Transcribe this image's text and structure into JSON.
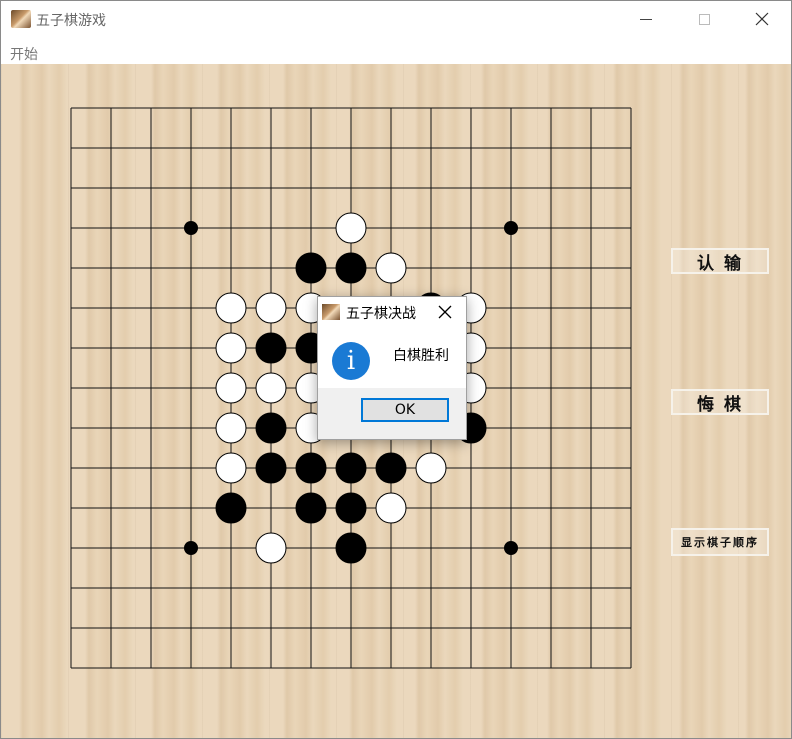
{
  "window": {
    "title": "五子棋游戏"
  },
  "menu": {
    "items": [
      "开始"
    ]
  },
  "buttons": {
    "resign": "认输",
    "undo": "悔棋",
    "show_order": "显示棋子顺序"
  },
  "board": {
    "size": 15,
    "star_points": [
      [
        3,
        3
      ],
      [
        11,
        3
      ],
      [
        3,
        11
      ],
      [
        11,
        11
      ]
    ],
    "stones": [
      {
        "col": 7,
        "row": 3,
        "color": "white"
      },
      {
        "col": 6,
        "row": 4,
        "color": "black"
      },
      {
        "col": 7,
        "row": 4,
        "color": "black"
      },
      {
        "col": 8,
        "row": 4,
        "color": "white"
      },
      {
        "col": 4,
        "row": 5,
        "color": "white"
      },
      {
        "col": 5,
        "row": 5,
        "color": "white"
      },
      {
        "col": 6,
        "row": 5,
        "color": "white"
      },
      {
        "col": 9,
        "row": 5,
        "color": "black"
      },
      {
        "col": 10,
        "row": 5,
        "color": "white"
      },
      {
        "col": 4,
        "row": 6,
        "color": "white"
      },
      {
        "col": 5,
        "row": 6,
        "color": "black"
      },
      {
        "col": 6,
        "row": 6,
        "color": "black"
      },
      {
        "col": 10,
        "row": 6,
        "color": "white"
      },
      {
        "col": 4,
        "row": 7,
        "color": "white"
      },
      {
        "col": 5,
        "row": 7,
        "color": "white"
      },
      {
        "col": 6,
        "row": 7,
        "color": "white"
      },
      {
        "col": 10,
        "row": 7,
        "color": "white"
      },
      {
        "col": 4,
        "row": 8,
        "color": "white"
      },
      {
        "col": 5,
        "row": 8,
        "color": "black"
      },
      {
        "col": 6,
        "row": 8,
        "color": "white"
      },
      {
        "col": 10,
        "row": 8,
        "color": "black"
      },
      {
        "col": 4,
        "row": 9,
        "color": "white"
      },
      {
        "col": 5,
        "row": 9,
        "color": "black"
      },
      {
        "col": 6,
        "row": 9,
        "color": "black"
      },
      {
        "col": 7,
        "row": 9,
        "color": "black"
      },
      {
        "col": 8,
        "row": 9,
        "color": "black"
      },
      {
        "col": 9,
        "row": 9,
        "color": "white"
      },
      {
        "col": 4,
        "row": 10,
        "color": "black"
      },
      {
        "col": 6,
        "row": 10,
        "color": "black"
      },
      {
        "col": 7,
        "row": 10,
        "color": "black"
      },
      {
        "col": 8,
        "row": 10,
        "color": "white"
      },
      {
        "col": 5,
        "row": 11,
        "color": "white"
      },
      {
        "col": 7,
        "row": 11,
        "color": "black"
      }
    ]
  },
  "dialog": {
    "title": "五子棋决战",
    "message": "白棋胜利",
    "ok_label": "OK",
    "icon": "info-icon"
  },
  "colors": {
    "accent": "#0078d7",
    "info": "#1a7ad4",
    "wood": "#e8d3b4"
  }
}
